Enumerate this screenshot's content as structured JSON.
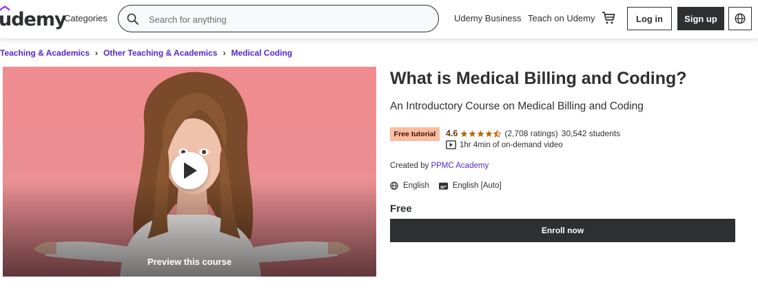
{
  "header": {
    "logo": "udemy",
    "categories_label": "Categories",
    "search_placeholder": "Search for anything",
    "udemy_business_label": "Udemy Business",
    "teach_label": "Teach on Udemy",
    "cart_icon": "cart-icon",
    "login_label": "Log in",
    "signup_label": "Sign up",
    "language_icon": "globe-icon"
  },
  "breadcrumb": [
    {
      "label": "Teaching & Academics"
    },
    {
      "label": "Other Teaching & Academics"
    },
    {
      "label": "Medical Coding"
    }
  ],
  "preview": {
    "label": "Preview this course",
    "play_icon": "play-icon"
  },
  "course": {
    "title": "What is Medical Billing and Coding?",
    "subtitle": "An Introductory Course on Medical Billing and Coding",
    "badge": "Free tutorial",
    "rating": "4.6",
    "rating_value": 4.6,
    "ratings_count": "(2,708 ratings)",
    "students": "30,542 students",
    "video_length": "1hr 4min of on-demand video",
    "created_by_label": "Created by",
    "instructor": "PPMC Academy",
    "language": "English",
    "captions": "English [Auto]",
    "price": "Free",
    "enroll_label": "Enroll now"
  },
  "colors": {
    "brand_purple": "#5624d0",
    "dark": "#2d2f31",
    "badge_bg": "#fcbca0",
    "star": "#b4690e"
  }
}
